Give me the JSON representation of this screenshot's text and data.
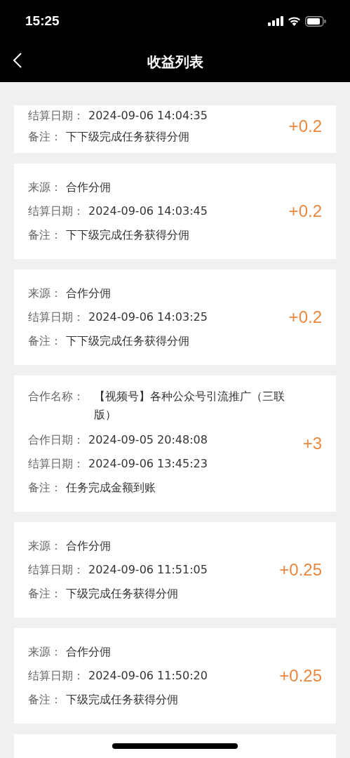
{
  "status_bar": {
    "time": "15:25"
  },
  "nav": {
    "title": "收益列表"
  },
  "records": [
    {
      "kind": "commission",
      "amount": "+0.2",
      "fields": [
        {
          "label": "结算日期：",
          "value": "2024-09-06 14:04:35"
        },
        {
          "label": "备注：",
          "value": "下下级完成任务获得分佣"
        }
      ]
    },
    {
      "kind": "commission",
      "amount": "+0.2",
      "fields": [
        {
          "label": "来源：",
          "value": "合作分佣"
        },
        {
          "label": "结算日期：",
          "value": "2024-09-06 14:03:45"
        },
        {
          "label": "备注：",
          "value": "下下级完成任务获得分佣"
        }
      ]
    },
    {
      "kind": "commission",
      "amount": "+0.2",
      "fields": [
        {
          "label": "来源：",
          "value": "合作分佣"
        },
        {
          "label": "结算日期：",
          "value": "2024-09-06 14:03:25"
        },
        {
          "label": "备注：",
          "value": "下下级完成任务获得分佣"
        }
      ]
    },
    {
      "kind": "cooperation",
      "amount": "+3",
      "fields": [
        {
          "label": "合作名称：",
          "value": "【视频号】各种公众号引流推广（三联版）"
        },
        {
          "label": "合作日期：",
          "value": "2024-09-05 20:48:08"
        },
        {
          "label": "结算日期：",
          "value": "2024-09-06 13:45:23"
        },
        {
          "label": "备注：",
          "value": "任务完成金额到账"
        }
      ]
    },
    {
      "kind": "commission",
      "amount": "+0.25",
      "fields": [
        {
          "label": "来源：",
          "value": "合作分佣"
        },
        {
          "label": "结算日期：",
          "value": "2024-09-06 11:51:05"
        },
        {
          "label": "备注：",
          "value": "下级完成任务获得分佣"
        }
      ]
    },
    {
      "kind": "commission",
      "amount": "+0.25",
      "fields": [
        {
          "label": "来源：",
          "value": "合作分佣"
        },
        {
          "label": "结算日期：",
          "value": "2024-09-06 11:50:20"
        },
        {
          "label": "备注：",
          "value": "下级完成任务获得分佣"
        }
      ]
    }
  ],
  "more_below": true
}
